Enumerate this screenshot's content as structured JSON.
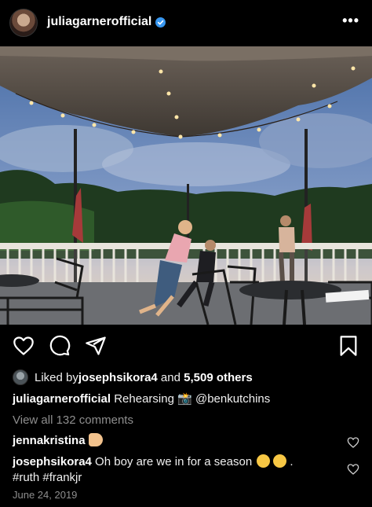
{
  "header": {
    "username": "juliagarnerofficial",
    "more_icon": "more-options-icon"
  },
  "photo": {
    "description_icon": "post-image"
  },
  "actions": {
    "like_icon": "heart-icon",
    "comment_icon": "comment-icon",
    "share_icon": "share-icon",
    "save_icon": "bookmark-icon"
  },
  "likes": {
    "prefix": "Liked by ",
    "user": "josephsikora4",
    "middle": " and ",
    "others": "5,509 others"
  },
  "caption": {
    "user": "juliagarnerofficial",
    "text": " Rehearsing ",
    "mention": " @benkutchins"
  },
  "view_comments": "View all 132 comments",
  "comments": [
    {
      "user": "jennakristina",
      "text": " "
    },
    {
      "user": "josephsikora4",
      "text": " Oh boy are we in for a season ",
      "trailing": ".",
      "line2": "#ruth #frankjr"
    }
  ],
  "date": "June 24, 2019",
  "colors": {
    "background": "#000000",
    "verified": "#3897f0",
    "muted": "#8e8e8e"
  }
}
